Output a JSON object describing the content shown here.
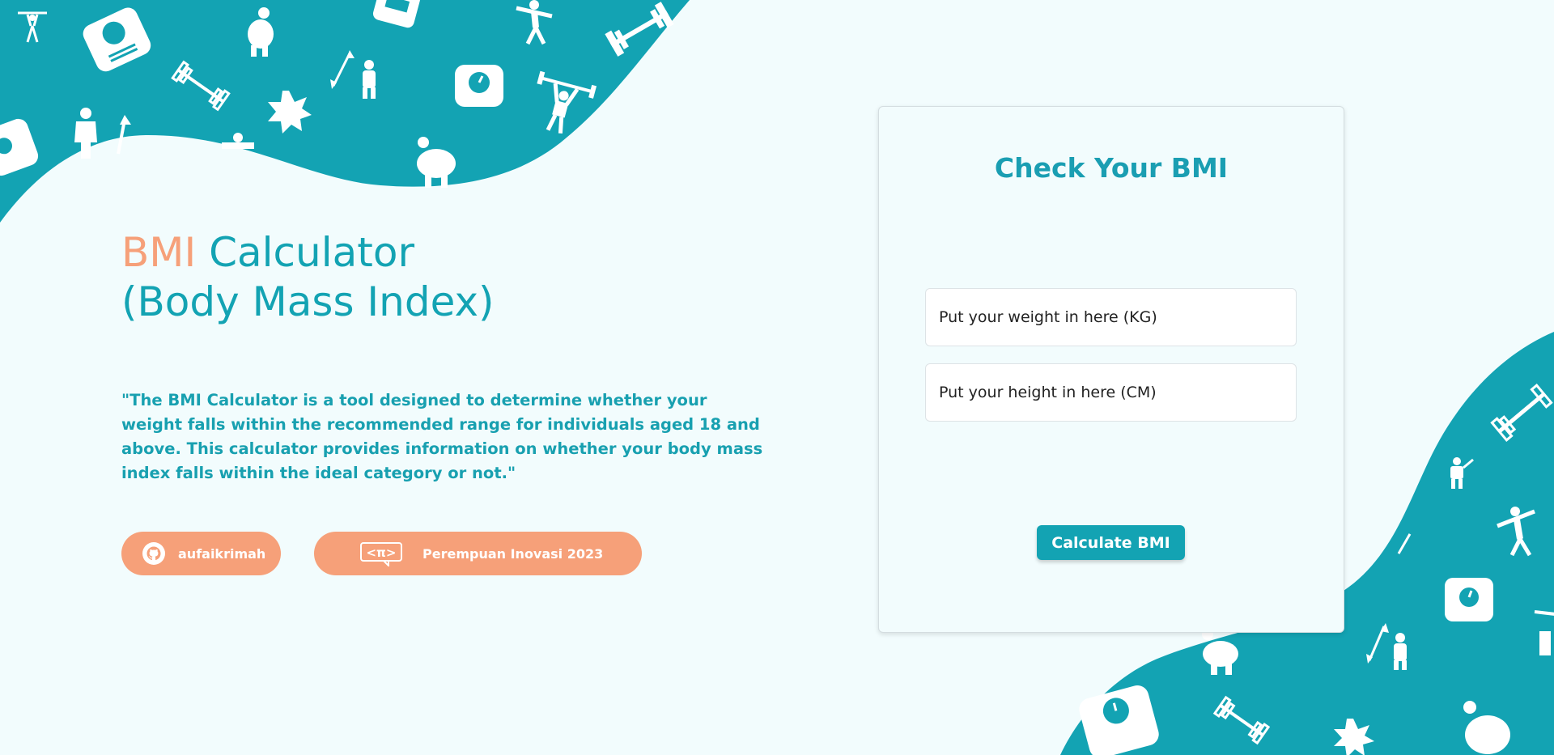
{
  "hero": {
    "title_accent": "BMI",
    "title_rest": "Calculator",
    "subtitle": "(Body Mass Index)",
    "description": "\"The BMI Calculator is a tool designed to determine whether your weight falls within the recommended range for individuals aged 18 and above. This calculator provides information on whether your body mass index falls within the ideal category or not.\""
  },
  "links": {
    "github_label": "aufaikrimah",
    "award_label": "Perempuan Inovasi 2023",
    "award_logo_text": "<π>"
  },
  "calculator": {
    "title": "Check Your BMI",
    "weight_placeholder": "Put your weight in here (KG)",
    "height_placeholder": "Put your height in here (CM)",
    "weight_value": "",
    "height_value": "",
    "submit_label": "Calculate BMI"
  },
  "colors": {
    "teal": "#13a3b3",
    "accent_orange": "#f6a079",
    "background": "#f2fcfd"
  },
  "icons": [
    "github-icon",
    "perempuan-inovasi-logo-icon",
    "weightlifter-icon",
    "scale-icon",
    "barbell-icon",
    "person-icon",
    "height-measure-icon",
    "starburst-icon",
    "stretch-person-icon"
  ]
}
